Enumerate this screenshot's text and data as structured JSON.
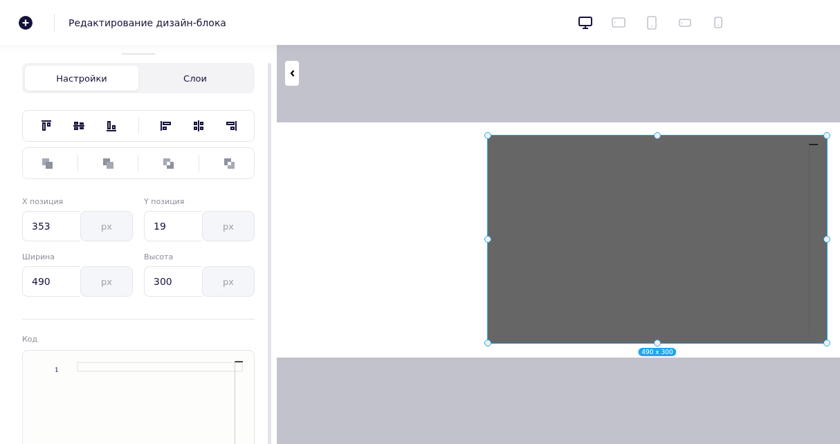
{
  "header": {
    "title": "Редактирование дизайн-блока",
    "devices": [
      {
        "kind": "desktop",
        "selected": true
      },
      {
        "kind": "tablet-landscape",
        "selected": false
      },
      {
        "kind": "tablet",
        "selected": false
      },
      {
        "kind": "phone-landscape",
        "selected": false
      },
      {
        "kind": "phone",
        "selected": false
      }
    ]
  },
  "panel": {
    "tabs": [
      {
        "label": "Настройки",
        "selected": true
      },
      {
        "label": "Слои",
        "selected": false
      }
    ],
    "fields": [
      {
        "label": "X позиция",
        "value": "353",
        "unit": "px"
      },
      {
        "label": "Y позиция",
        "value": "19",
        "unit": "px"
      },
      {
        "label": "Ширина",
        "value": "490",
        "unit": "px"
      },
      {
        "label": "Высота",
        "value": "300",
        "unit": "px"
      }
    ],
    "code": {
      "label": "Код",
      "line_numbers": [
        "1"
      ]
    }
  },
  "canvas": {
    "size_badge": "490 x 300"
  }
}
